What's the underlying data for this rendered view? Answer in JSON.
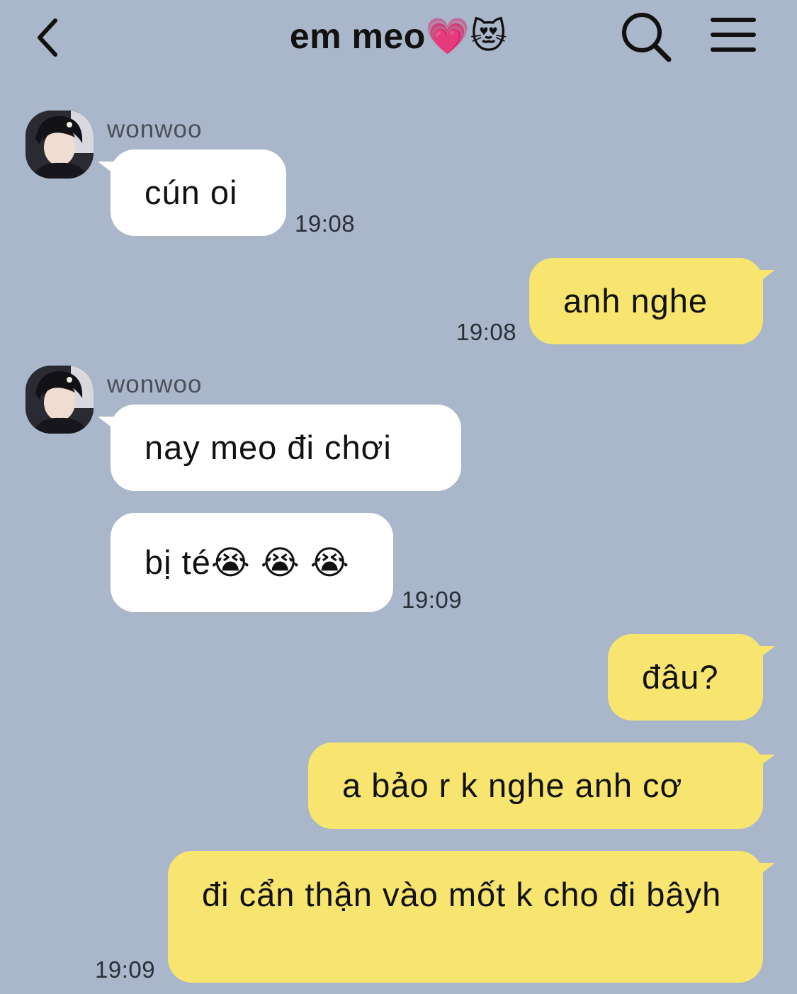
{
  "header": {
    "title": "em meo💗😻",
    "icons": {
      "back": "chevron-left-icon",
      "search": "search-icon",
      "menu": "hamburger-menu-icon"
    }
  },
  "messages": [
    {
      "sender": "wonwoo",
      "text": "cún oi",
      "time": "19:08"
    },
    {
      "text": "anh nghe",
      "time": "19:08",
      "outgoing": true
    },
    {
      "sender": "wonwoo",
      "text": "nay meo đi chơi"
    },
    {
      "text": "bị té😭 😭 😭",
      "time": "19:09"
    },
    {
      "text": "đâu?",
      "outgoing": true
    },
    {
      "text": "a bảo r k nghe anh cơ",
      "outgoing": true
    },
    {
      "text": "đi cẩn thận vào mốt k cho đi bâyh",
      "time": "19:09",
      "outgoing": true
    }
  ],
  "colors": {
    "background": "#aab6c9",
    "incoming_bubble": "#ffffff",
    "outgoing_bubble": "#f7e56f"
  }
}
